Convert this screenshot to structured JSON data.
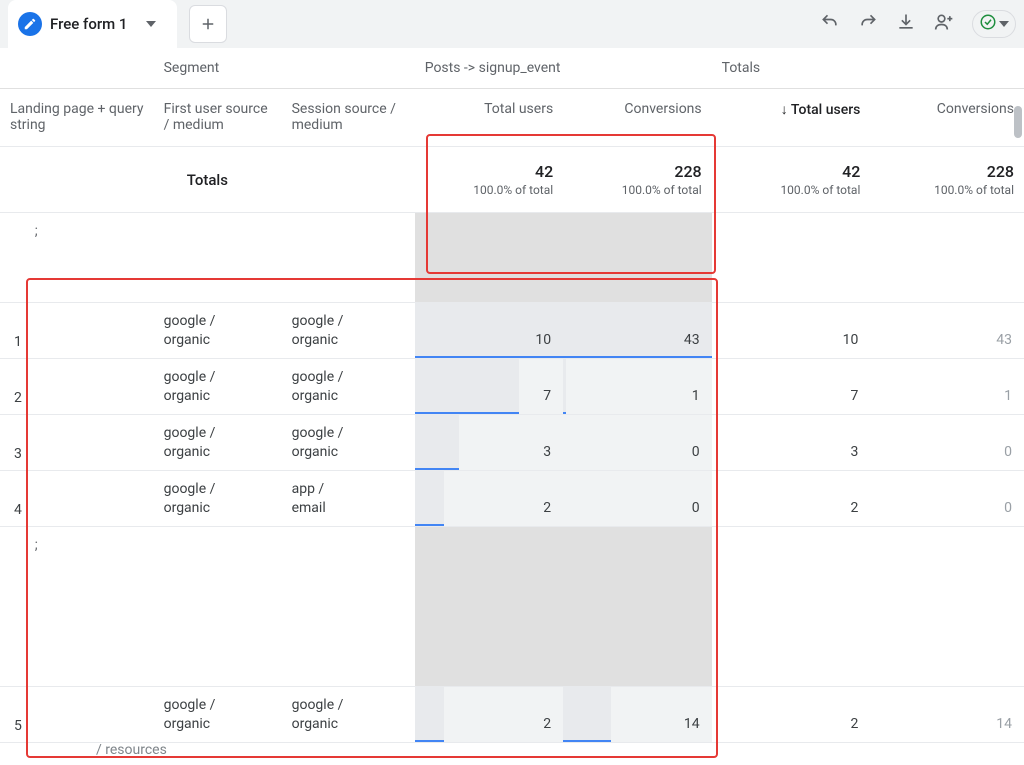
{
  "tab": {
    "label": "Free form 1"
  },
  "headers": {
    "segment": "Segment",
    "posts": "Posts -> signup_event",
    "totalsSection": "Totals",
    "landing": "Landing page + query string",
    "firstUser": "First user source / medium",
    "sessionSrc": "Session source / medium",
    "metric1": "Total users",
    "metric2": "Conversions",
    "sortPrefix": "↓ ",
    "sortMetric": "Total users"
  },
  "totals": {
    "label": "Totals",
    "users": "42",
    "usersPct": "100.0% of total",
    "conv": "228",
    "convPct": "100.0% of total"
  },
  "urlFrag": ";",
  "rows": [
    {
      "idx": "1",
      "src1": "google / organic",
      "src2": "google / organic",
      "u1": "10",
      "c1": "43",
      "u2": "10",
      "c2": "43",
      "ub": 100,
      "cb": 100,
      "ubg": 100,
      "cbg": 100
    },
    {
      "idx": "2",
      "src1": "google / organic",
      "src2": "google / organic",
      "u1": "7",
      "c1": "1",
      "u2": "7",
      "c2": "1",
      "ub": 70,
      "cb": 2,
      "ubg": 70,
      "cbg": 2
    },
    {
      "idx": "3",
      "src1": "google / organic",
      "src2": "google / organic",
      "u1": "3",
      "c1": "0",
      "u2": "3",
      "c2": "0",
      "ub": 30,
      "cb": 0,
      "ubg": 30,
      "cbg": 0
    },
    {
      "idx": "4",
      "src1": "google / organic",
      "src2": "app / email",
      "u1": "2",
      "c1": "0",
      "u2": "2",
      "c2": "0",
      "ub": 20,
      "cb": 0,
      "ubg": 20,
      "cbg": 0
    },
    {
      "idx": "5",
      "src1": "google / organic",
      "src2": "google / organic",
      "u1": "2",
      "c1": "14",
      "u2": "2",
      "c2": "14",
      "ub": 20,
      "cb": 32,
      "ubg": 20,
      "cbg": 32
    }
  ],
  "bottomFrag": "/ resources"
}
